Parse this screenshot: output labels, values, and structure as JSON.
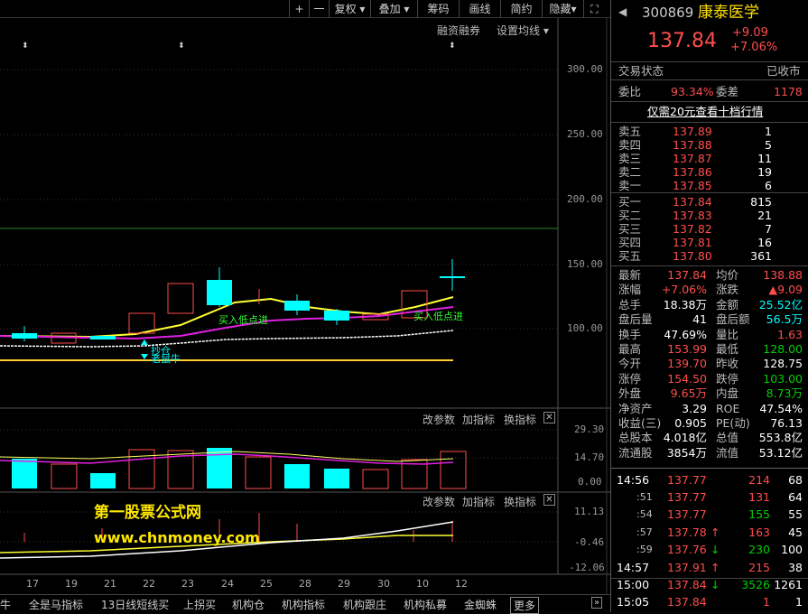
{
  "toolbar": {
    "plus": "+",
    "minus": "一",
    "fq": "复权",
    "overlay": "叠加",
    "chip": "筹码",
    "draw": "画线",
    "simple": "简约",
    "hide": "隐藏",
    "fullscreen": "⛶"
  },
  "main_panel": {
    "margin_btn": "融资融券",
    "ma_btn": "设置均线",
    "ax": [
      "300.00",
      "250.00",
      "200.00",
      "150.00",
      "100.00"
    ],
    "signals": {
      "buy1": "买入低点进",
      "buy2": "买入低点进",
      "s1": "抄仓",
      "s2": "老鼠牛"
    }
  },
  "sub_panel1": {
    "modify": "改参数",
    "add": "加指标",
    "switch": "换指标",
    "ax": [
      "29.30",
      "14.70",
      "0.00"
    ]
  },
  "sub_panel2": {
    "modify": "改参数",
    "add": "加指标",
    "switch": "换指标",
    "ax": [
      "11.13",
      "-0.46",
      "-12.06"
    ]
  },
  "watermark": {
    "line1": "第一股票公式网",
    "line2": "www.chnmoney.com"
  },
  "dates": [
    "17",
    "19",
    "21",
    "22",
    "23",
    "24",
    "25",
    "28",
    "29",
    "30",
    "10",
    "12"
  ],
  "bottom_tabs": [
    "牛",
    "全是马指标",
    "13日线短线买",
    "上拐买",
    "机构仓",
    "机构指标",
    "机构跟庄",
    "机构私募",
    "金蜘蛛",
    "更多"
  ],
  "bottom_more": "»",
  "stock": {
    "code": "300869",
    "name": "康泰医学",
    "price": "137.84",
    "chg": "+9.09",
    "pct": "+7.06%"
  },
  "status": {
    "label": "交易状态",
    "value": "已收市"
  },
  "commission": {
    "ratio_l": "委比",
    "ratio": "93.34%",
    "diff_l": "委差",
    "diff": "1178"
  },
  "promo": "仅需20元查看十档行情",
  "asks": [
    {
      "l": "卖五",
      "p": "137.89",
      "v": "1"
    },
    {
      "l": "卖四",
      "p": "137.88",
      "v": "5"
    },
    {
      "l": "卖三",
      "p": "137.87",
      "v": "11"
    },
    {
      "l": "卖二",
      "p": "137.86",
      "v": "19"
    },
    {
      "l": "卖一",
      "p": "137.85",
      "v": "6"
    }
  ],
  "bids": [
    {
      "l": "买一",
      "p": "137.84",
      "v": "815"
    },
    {
      "l": "买二",
      "p": "137.83",
      "v": "21"
    },
    {
      "l": "买三",
      "p": "137.82",
      "v": "7"
    },
    {
      "l": "买四",
      "p": "137.81",
      "v": "16"
    },
    {
      "l": "买五",
      "p": "137.80",
      "v": "361"
    }
  ],
  "stats": [
    {
      "l1": "最新",
      "v1": "137.84",
      "c1": "red",
      "l2": "均价",
      "v2": "138.88",
      "c2": "red"
    },
    {
      "l1": "涨幅",
      "v1": "+7.06%",
      "c1": "red",
      "l2": "涨跌",
      "v2": "▲9.09",
      "c2": "red"
    },
    {
      "l1": "总手",
      "v1": "18.38万",
      "c1": "wht",
      "l2": "金额",
      "v2": "25.52亿",
      "c2": "cyan"
    },
    {
      "l1": "盘后量",
      "v1": "41",
      "c1": "wht",
      "l2": "盘后额",
      "v2": "56.5万",
      "c2": "cyan"
    },
    {
      "l1": "换手",
      "v1": "47.69%",
      "c1": "wht",
      "l2": "量比",
      "v2": "1.63",
      "c2": "red"
    },
    {
      "l1": "最高",
      "v1": "153.99",
      "c1": "red",
      "l2": "最低",
      "v2": "128.00",
      "c2": "grn"
    },
    {
      "l1": "今开",
      "v1": "139.70",
      "c1": "red",
      "l2": "昨收",
      "v2": "128.75",
      "c2": "wht"
    },
    {
      "l1": "涨停",
      "v1": "154.50",
      "c1": "red",
      "l2": "跌停",
      "v2": "103.00",
      "c2": "grn"
    },
    {
      "l1": "外盘",
      "v1": "9.65万",
      "c1": "red",
      "l2": "内盘",
      "v2": "8.73万",
      "c2": "grn"
    },
    {
      "l1": "净资产",
      "v1": "3.29",
      "c1": "wht",
      "l2": "ROE",
      "v2": "47.54%",
      "c2": "wht"
    },
    {
      "l1": "收益(三)",
      "v1": "0.905",
      "c1": "wht",
      "l2": "PE(动)",
      "v2": "76.13",
      "c2": "wht"
    },
    {
      "l1": "总股本",
      "v1": "4.018亿",
      "c1": "wht",
      "l2": "总值",
      "v2": "553.8亿",
      "c2": "wht"
    },
    {
      "l1": "流通股",
      "v1": "3854万",
      "c1": "wht",
      "l2": "流值",
      "v2": "53.12亿",
      "c2": "wht"
    }
  ],
  "ticks": [
    {
      "t": "14:56",
      "p": "137.77",
      "a": "",
      "v": "214",
      "vc": "red",
      "n": "68"
    },
    {
      "t": ":51",
      "p": "137.77",
      "a": "",
      "v": "131",
      "vc": "red",
      "n": "64"
    },
    {
      "t": ":54",
      "p": "137.77",
      "a": "",
      "v": "155",
      "vc": "grn",
      "n": "55"
    },
    {
      "t": ":57",
      "p": "137.78",
      "a": "↑",
      "v": "163",
      "vc": "red",
      "n": "45"
    },
    {
      "t": ":59",
      "p": "137.76",
      "a": "↓",
      "v": "230",
      "vc": "grn",
      "n": "100"
    },
    {
      "t": "14:57",
      "p": "137.91",
      "a": "↑",
      "v": "215",
      "vc": "red",
      "n": "38"
    },
    {
      "t": "15:00",
      "p": "137.84",
      "a": "↓",
      "v": "3526",
      "vc": "grn",
      "n": "1261"
    },
    {
      "t": "15:05",
      "p": "137.84",
      "a": "",
      "v": "1",
      "vc": "red",
      "n": "1"
    }
  ]
}
